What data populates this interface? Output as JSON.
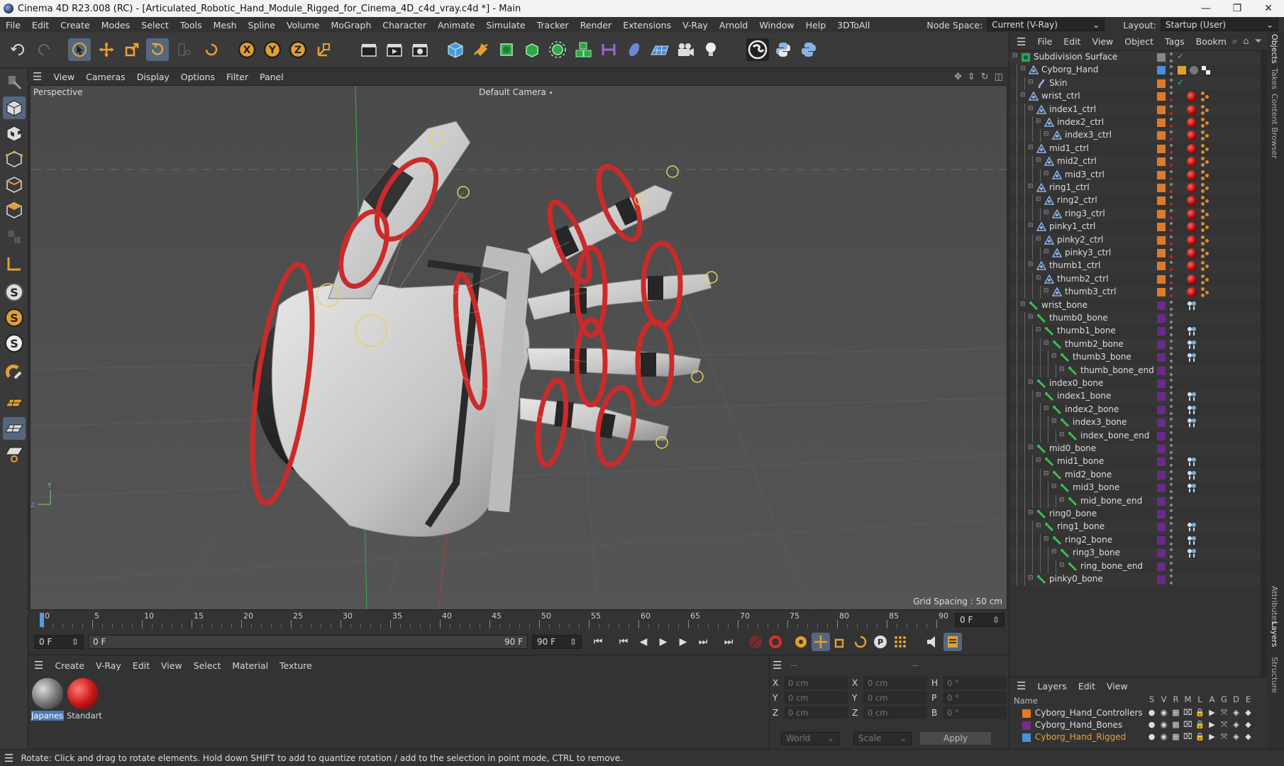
{
  "window": {
    "title": "Cinema 4D R23.008 (RC) - [Articulated_Robotic_Hand_Module_Rigged_for_Cinema_4D_c4d_vray.c4d *] - Main",
    "min": "—",
    "max": "❐",
    "close": "✕"
  },
  "menu": [
    "File",
    "Edit",
    "Create",
    "Modes",
    "Select",
    "Tools",
    "Mesh",
    "Spline",
    "Volume",
    "MoGraph",
    "Character",
    "Animate",
    "Simulate",
    "Tracker",
    "Render",
    "Extensions",
    "V-Ray",
    "Arnold",
    "Window",
    "Help",
    "3DToAll"
  ],
  "nodespace": {
    "label": "Node Space:",
    "value": "Current (V-Ray)"
  },
  "layout": {
    "label": "Layout:",
    "value": "Startup (User)"
  },
  "viewport": {
    "menu": [
      "View",
      "Cameras",
      "Display",
      "Options",
      "Filter",
      "Panel"
    ],
    "projection": "Perspective",
    "camera": "Default Camera",
    "grid": "Grid Spacing : 50 cm"
  },
  "timeline": {
    "ticks": [
      "0",
      "5",
      "10",
      "15",
      "20",
      "25",
      "30",
      "35",
      "40",
      "45",
      "50",
      "55",
      "60",
      "65",
      "70",
      "75",
      "80",
      "85",
      "90"
    ],
    "current": "0 F",
    "start": "0 F",
    "range_start": "0 F",
    "range_end": "90 F",
    "end": "90 F"
  },
  "materials": {
    "menu": [
      "Create",
      "V-Ray",
      "Edit",
      "View",
      "Select",
      "Material",
      "Texture"
    ],
    "items": [
      {
        "name": "Japanese"
      },
      {
        "name": "Standart"
      }
    ]
  },
  "coords": {
    "header": "--",
    "rows": [
      {
        "a": "X",
        "av": "0 cm",
        "b": "X",
        "bv": "0 cm",
        "c": "H",
        "cv": "0 °"
      },
      {
        "a": "Y",
        "av": "0 cm",
        "b": "Y",
        "bv": "0 cm",
        "c": "P",
        "cv": "0 °"
      },
      {
        "a": "Z",
        "av": "0 cm",
        "b": "Z",
        "bv": "0 cm",
        "c": "B",
        "cv": "0 °"
      }
    ],
    "mode1": "World",
    "mode2": "Scale",
    "apply": "Apply"
  },
  "objects": {
    "menu": [
      "File",
      "Edit",
      "View",
      "Object",
      "Tags",
      "Bookm"
    ],
    "items": [
      {
        "name": "Subdivision Surface",
        "level": 0,
        "kind": "subd",
        "color": "#888888"
      },
      {
        "name": "Cyborg_Hand",
        "level": 1,
        "kind": "null",
        "color": "#4a8fd8"
      },
      {
        "name": "Skin",
        "level": 2,
        "kind": "skin",
        "color": "#e07a2a"
      },
      {
        "name": "wrist_ctrl",
        "level": 1,
        "kind": "ctrl",
        "color": "#e07a2a"
      },
      {
        "name": "index1_ctrl",
        "level": 2,
        "kind": "ctrl",
        "color": "#e07a2a"
      },
      {
        "name": "index2_ctrl",
        "level": 3,
        "kind": "ctrl",
        "color": "#e07a2a"
      },
      {
        "name": "index3_ctrl",
        "level": 4,
        "kind": "ctrl",
        "color": "#e07a2a"
      },
      {
        "name": "mid1_ctrl",
        "level": 2,
        "kind": "ctrl",
        "color": "#e07a2a"
      },
      {
        "name": "mid2_ctrl",
        "level": 3,
        "kind": "ctrl",
        "color": "#e07a2a"
      },
      {
        "name": "mid3_ctrl",
        "level": 4,
        "kind": "ctrl",
        "color": "#e07a2a"
      },
      {
        "name": "ring1_ctrl",
        "level": 2,
        "kind": "ctrl",
        "color": "#e07a2a"
      },
      {
        "name": "ring2_ctrl",
        "level": 3,
        "kind": "ctrl",
        "color": "#e07a2a"
      },
      {
        "name": "ring3_ctrl",
        "level": 4,
        "kind": "ctrl",
        "color": "#e07a2a"
      },
      {
        "name": "pinky1_ctrl",
        "level": 2,
        "kind": "ctrl",
        "color": "#e07a2a"
      },
      {
        "name": "pinky2_ctrl",
        "level": 3,
        "kind": "ctrl",
        "color": "#e07a2a"
      },
      {
        "name": "pinky3_ctrl",
        "level": 4,
        "kind": "ctrl",
        "color": "#e07a2a"
      },
      {
        "name": "thumb1_ctrl",
        "level": 2,
        "kind": "ctrl",
        "color": "#e07a2a"
      },
      {
        "name": "thumb2_ctrl",
        "level": 3,
        "kind": "ctrl",
        "color": "#e07a2a"
      },
      {
        "name": "thumb3_ctrl",
        "level": 4,
        "kind": "ctrl",
        "color": "#e07a2a"
      },
      {
        "name": "wrist_bone",
        "level": 1,
        "kind": "bone",
        "color": "#6a2a8a"
      },
      {
        "name": "thumb0_bone",
        "level": 2,
        "kind": "bone",
        "color": "#6a2a8a"
      },
      {
        "name": "thumb1_bone",
        "level": 3,
        "kind": "bone",
        "color": "#6a2a8a"
      },
      {
        "name": "thumb2_bone",
        "level": 4,
        "kind": "bone",
        "color": "#6a2a8a"
      },
      {
        "name": "thumb3_bone",
        "level": 5,
        "kind": "bone",
        "color": "#6a2a8a"
      },
      {
        "name": "thumb_bone_end",
        "level": 6,
        "kind": "boneend",
        "color": "#6a2a8a"
      },
      {
        "name": "index0_bone",
        "level": 2,
        "kind": "bone",
        "color": "#6a2a8a"
      },
      {
        "name": "index1_bone",
        "level": 3,
        "kind": "bone",
        "color": "#6a2a8a"
      },
      {
        "name": "index2_bone",
        "level": 4,
        "kind": "bone",
        "color": "#6a2a8a"
      },
      {
        "name": "index3_bone",
        "level": 5,
        "kind": "bone",
        "color": "#6a2a8a"
      },
      {
        "name": "index_bone_end",
        "level": 6,
        "kind": "boneend",
        "color": "#6a2a8a"
      },
      {
        "name": "mid0_bone",
        "level": 2,
        "kind": "bone",
        "color": "#6a2a8a"
      },
      {
        "name": "mid1_bone",
        "level": 3,
        "kind": "bone",
        "color": "#6a2a8a"
      },
      {
        "name": "mid2_bone",
        "level": 4,
        "kind": "bone",
        "color": "#6a2a8a"
      },
      {
        "name": "mid3_bone",
        "level": 5,
        "kind": "bone",
        "color": "#6a2a8a"
      },
      {
        "name": "mid_bone_end",
        "level": 6,
        "kind": "boneend",
        "color": "#6a2a8a"
      },
      {
        "name": "ring0_bone",
        "level": 2,
        "kind": "bone",
        "color": "#6a2a8a"
      },
      {
        "name": "ring1_bone",
        "level": 3,
        "kind": "bone",
        "color": "#6a2a8a"
      },
      {
        "name": "ring2_bone",
        "level": 4,
        "kind": "bone",
        "color": "#6a2a8a"
      },
      {
        "name": "ring3_bone",
        "level": 5,
        "kind": "bone",
        "color": "#6a2a8a"
      },
      {
        "name": "ring_bone_end",
        "level": 6,
        "kind": "boneend",
        "color": "#6a2a8a"
      },
      {
        "name": "pinky0_bone",
        "level": 2,
        "kind": "bone",
        "color": "#6a2a8a"
      }
    ]
  },
  "layers": {
    "menu": [
      "Layers",
      "Edit",
      "View"
    ],
    "headers": {
      "name": "Name",
      "cols": [
        "S",
        "V",
        "R",
        "M",
        "L",
        "A",
        "G",
        "D",
        "E"
      ]
    },
    "items": [
      {
        "name": "Cyborg_Hand_Controllers",
        "color": "#e07a2a",
        "active": false
      },
      {
        "name": "Cyborg_Hand_Bones",
        "color": "#7a2a8a",
        "active": false
      },
      {
        "name": "Cyborg_Hand_Rigged",
        "color": "#4a8fd8",
        "active": true
      }
    ]
  },
  "sidetabs": [
    "Objects",
    "Takes",
    "Content Browser",
    "Attributes",
    "Layers",
    "Structure"
  ],
  "status": "Rotate: Click and drag to rotate elements. Hold down SHIFT to add to quantize rotation / add to the selection in point mode, CTRL to remove.",
  "colors": {
    "accent": "#55677f",
    "selected_layer": "#e8a43c",
    "ctrl_ring": "#cc2a2a"
  }
}
